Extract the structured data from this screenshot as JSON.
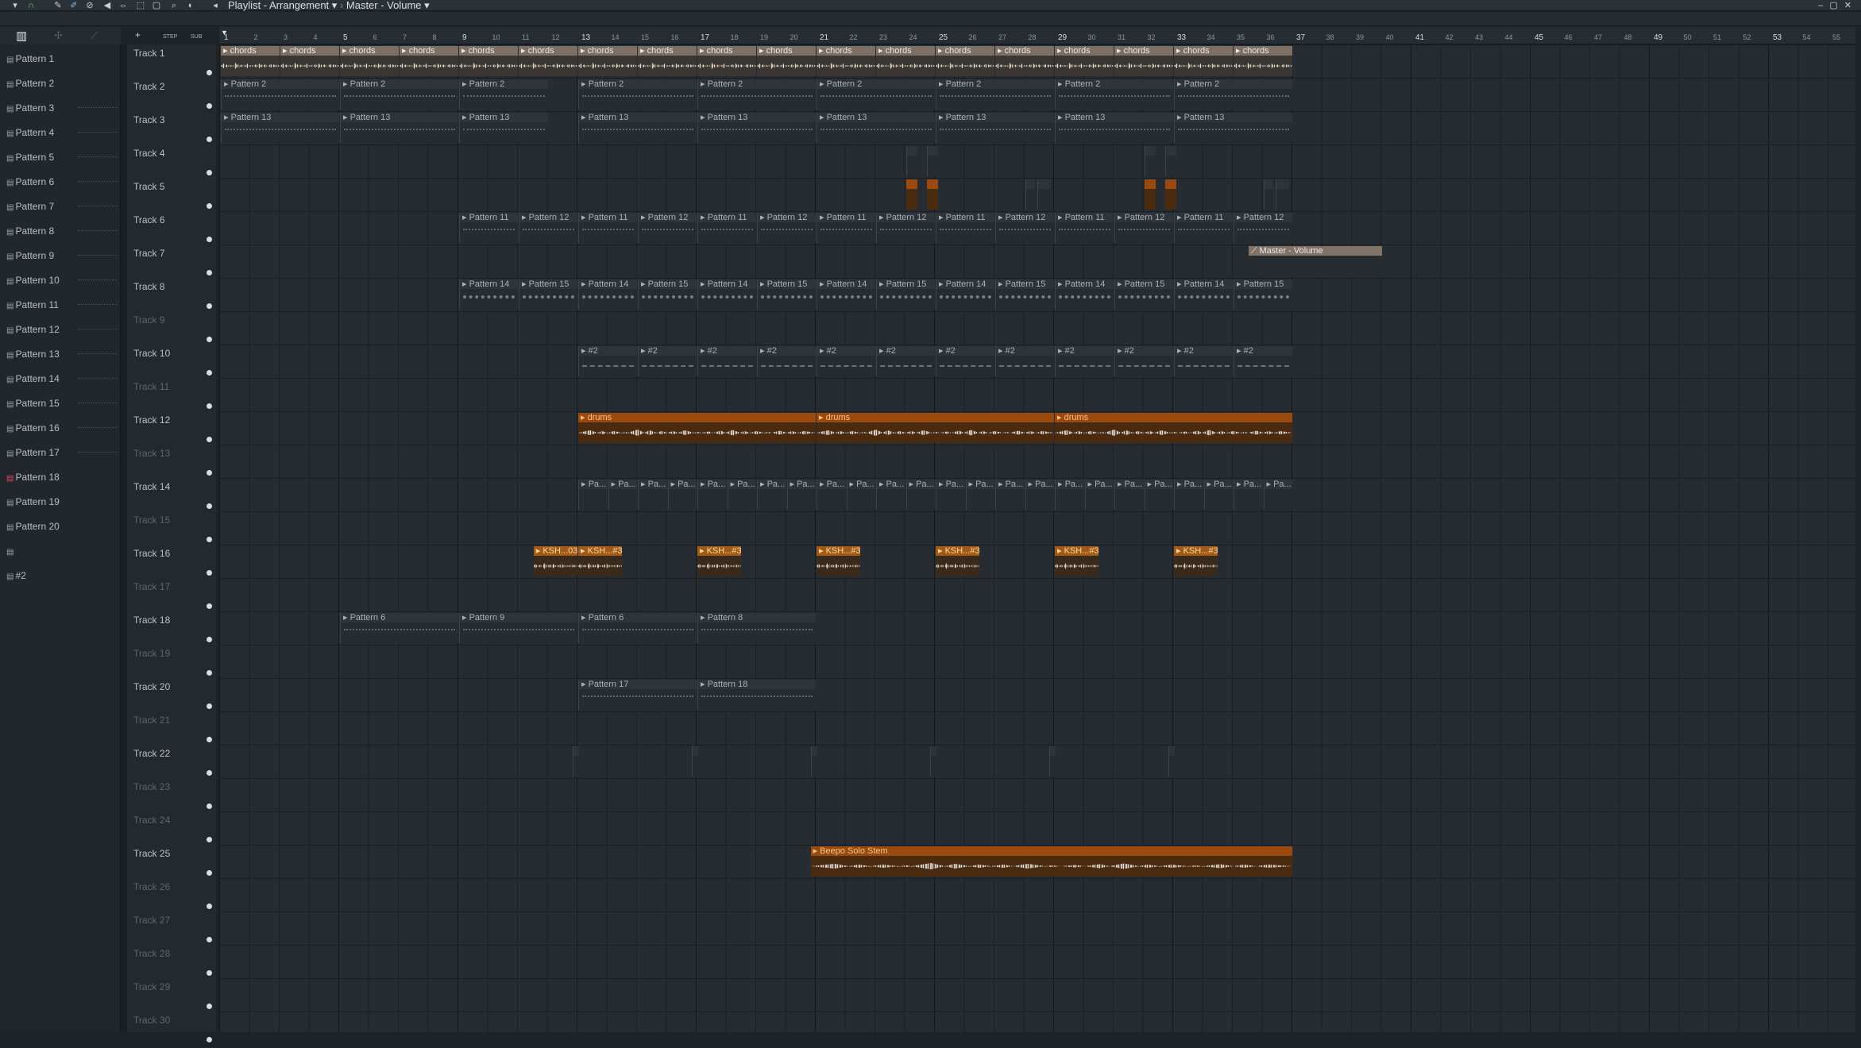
{
  "window": {
    "title": "Playlist - Arrangement",
    "breadcrumb_sep": "›",
    "automation": "Master - Volume"
  },
  "toolbar": {
    "icons": [
      "menu-arrow-icon",
      "magnet-icon",
      "pencil-icon",
      "paint-icon",
      "delete-icon",
      "mute-icon",
      "slip-icon",
      "select-icon",
      "zoom-icon",
      "playback-icon",
      "speaker-icon"
    ],
    "step_label": "STEP",
    "sub_label": "SUB"
  },
  "ruler": [
    "1",
    "2",
    "3",
    "4",
    "5",
    "6",
    "7",
    "8",
    "9",
    "10",
    "11",
    "12",
    "13",
    "14",
    "15",
    "16",
    "17",
    "18",
    "19",
    "20",
    "21",
    "22",
    "23",
    "24",
    "25",
    "26",
    "27",
    "28",
    "29",
    "30",
    "31",
    "32",
    "33",
    "34",
    "35",
    "36",
    "37",
    "38",
    "39",
    "40",
    "41",
    "42",
    "43",
    "44",
    "45",
    "46",
    "47",
    "48",
    "49",
    "50",
    "51",
    "52",
    "53",
    "54",
    "55"
  ],
  "patterns": [
    "Pattern 1",
    "Pattern 2",
    "Pattern 3",
    "Pattern 4",
    "Pattern 5",
    "Pattern 6",
    "Pattern 7",
    "Pattern 8",
    "Pattern 9",
    "Pattern 10",
    "Pattern 11",
    "Pattern 12",
    "Pattern 13",
    "Pattern 14",
    "Pattern 15",
    "Pattern 16",
    "Pattern 17",
    "Pattern 18",
    "Pattern 19",
    "Pattern 20",
    "",
    "#2"
  ],
  "selected_pattern": "Pattern 18",
  "tracks": [
    "Track 1",
    "Track 2",
    "Track 3",
    "Track 4",
    "Track 5",
    "Track 6",
    "Track 7",
    "Track 8",
    "Track 9",
    "Track 10",
    "Track 11",
    "Track 12",
    "Track 13",
    "Track 14",
    "Track 15",
    "Track 16",
    "Track 17",
    "Track 18",
    "Track 19",
    "Track 20",
    "Track 21",
    "Track 22",
    "Track 23",
    "Track 24",
    "Track 25",
    "Track 26",
    "Track 27",
    "Track 28",
    "Track 29",
    "Track 30"
  ],
  "dim_tracks": [
    "Track 9",
    "Track 11",
    "Track 13",
    "Track 15",
    "Track 17",
    "Track 19",
    "Track 21",
    "Track 23",
    "Track 24",
    "Track 26",
    "Track 27",
    "Track 28",
    "Track 29",
    "Track 30"
  ],
  "clip_labels": {
    "chords": "chords",
    "p2": "Pattern 2",
    "p13": "Pattern 13",
    "p11": "Pattern 11",
    "p12": "Pattern 12",
    "p14": "Pattern 14",
    "p15": "Pattern 15",
    "auto": "Master - Volume",
    "hash2": "#2",
    "drums": "drums",
    "pa": "Pa...",
    "ksh3": "KSH...#3",
    "ksh03": "KSH...03",
    "p6": "Pattern 6",
    "p9": "Pattern 9",
    "p8": "Pattern 8",
    "p17": "Pattern 17",
    "p18": "Pattern 18",
    "solo": "Beepo Solo Stem"
  },
  "colors": {
    "chords": "#7d6f63",
    "orange": "#9a4a0f",
    "selected": "#e0445e"
  }
}
